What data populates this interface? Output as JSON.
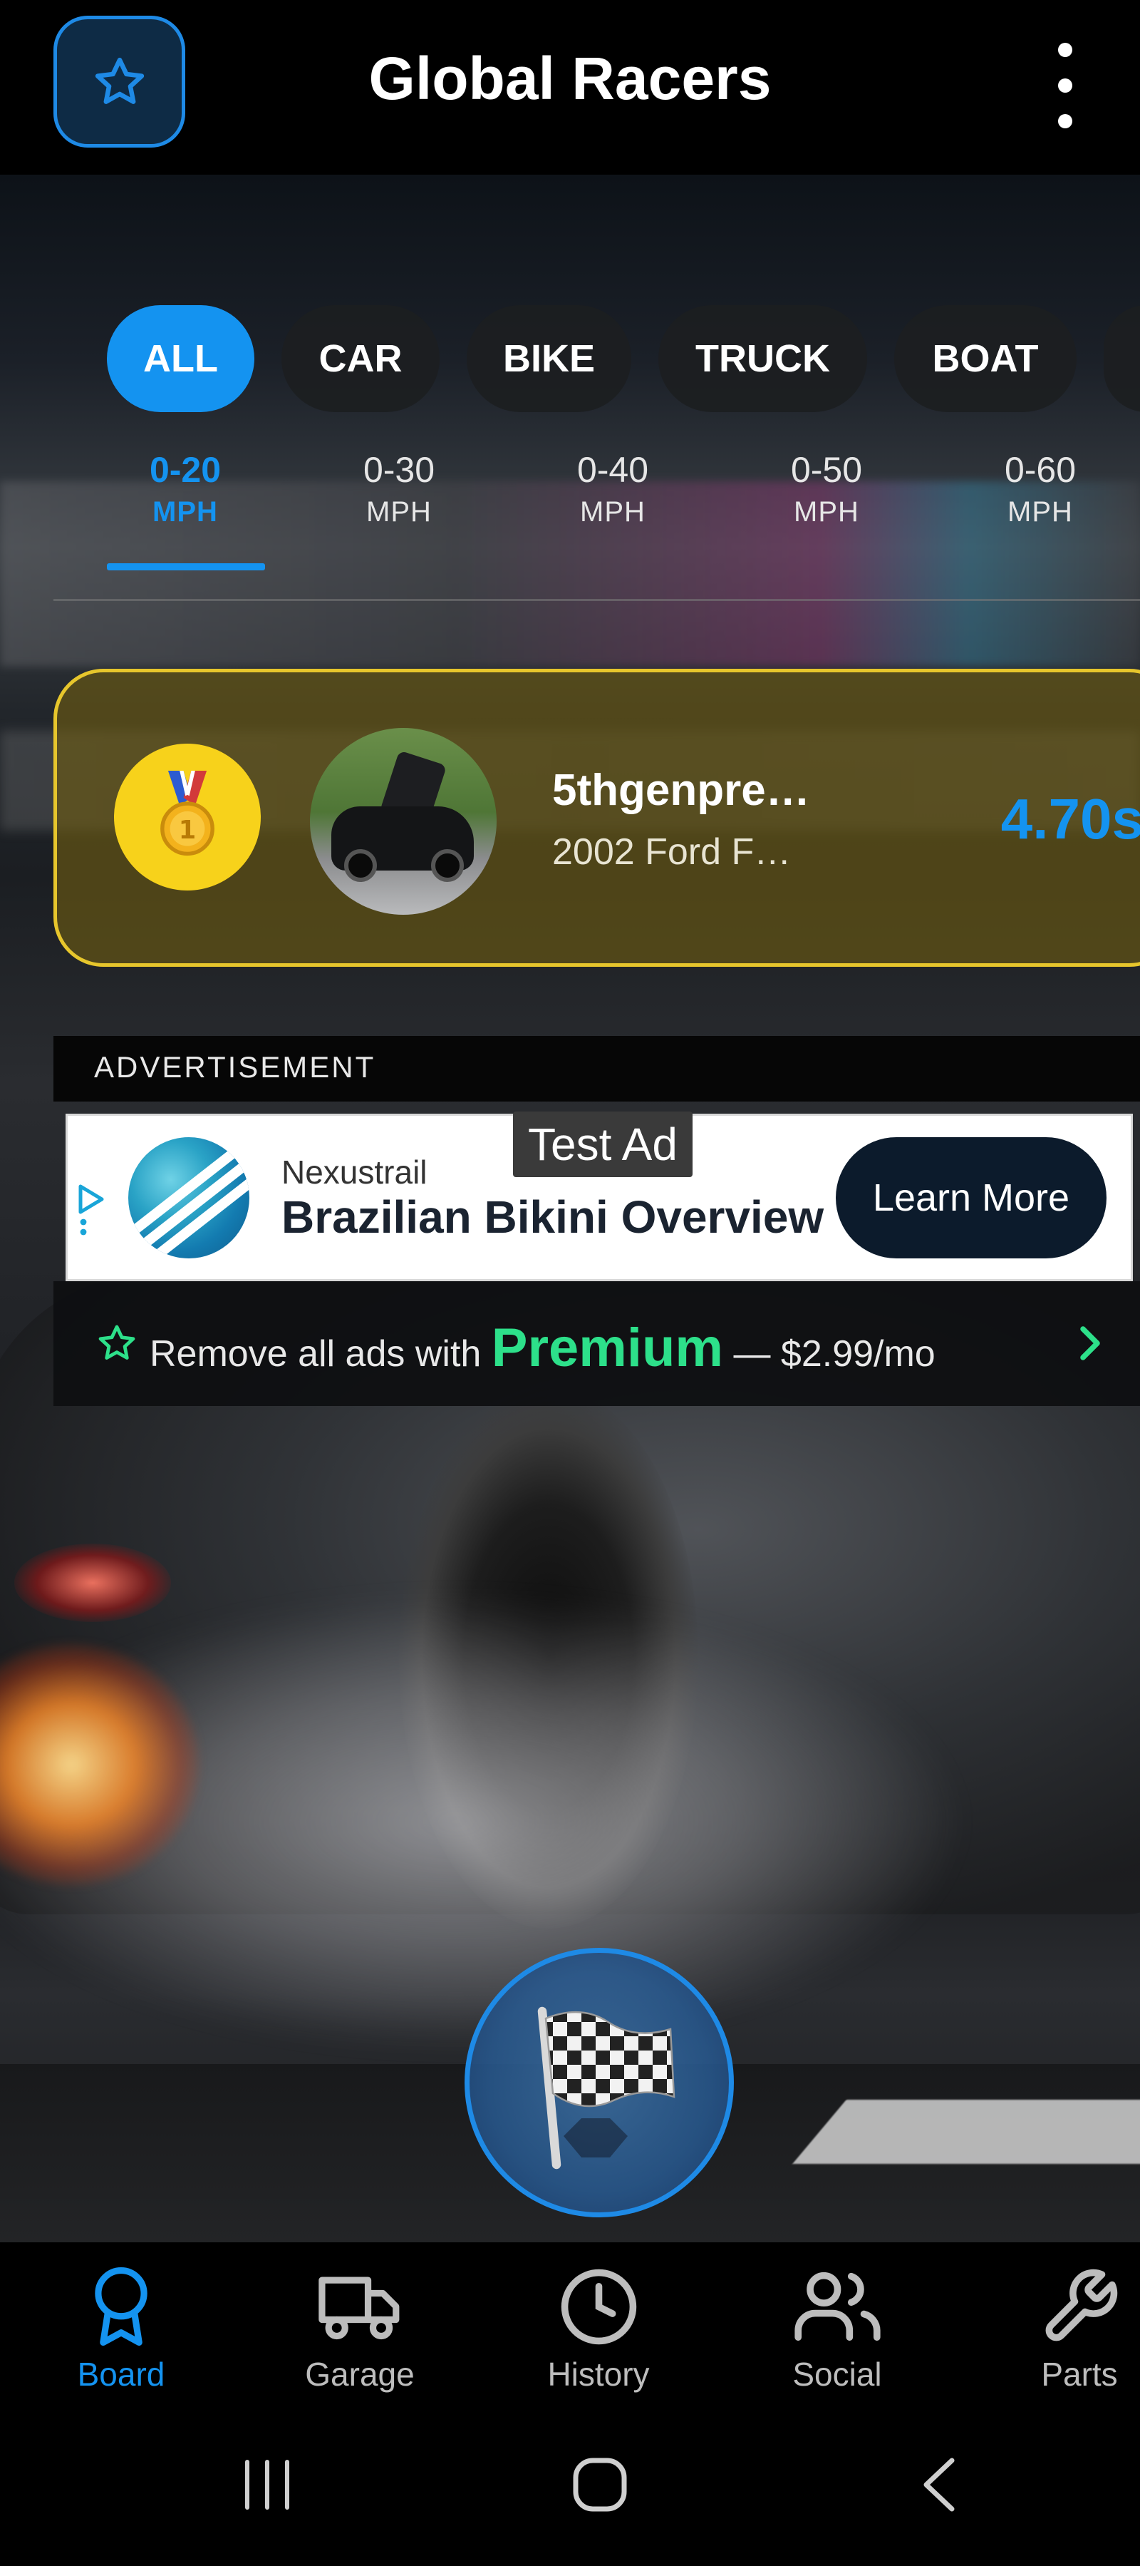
{
  "header": {
    "title": "Global Racers",
    "favorite_icon": "star-icon",
    "menu_icon": "more-vertical-icon"
  },
  "vehicle_filters": [
    {
      "label": "ALL",
      "active": true
    },
    {
      "label": "CAR",
      "active": false
    },
    {
      "label": "BIKE",
      "active": false
    },
    {
      "label": "TRUCK",
      "active": false
    },
    {
      "label": "BOAT",
      "active": false
    }
  ],
  "speed_tabs": [
    {
      "range": "0-20",
      "unit": "MPH",
      "active": true
    },
    {
      "range": "0-30",
      "unit": "MPH",
      "active": false
    },
    {
      "range": "0-40",
      "unit": "MPH",
      "active": false
    },
    {
      "range": "0-50",
      "unit": "MPH",
      "active": false
    },
    {
      "range": "0-60",
      "unit": "MPH",
      "active": false
    }
  ],
  "leaderboard": [
    {
      "rank_icon": "gold-medal-icon",
      "racer": "5thgenpre…",
      "vehicle": "2002 Ford F…",
      "time": "4.70s"
    }
  ],
  "ad": {
    "section_label": "ADVERTISEMENT",
    "badge": "Test Ad",
    "brand": "Nexustrail",
    "headline": "Brazilian Bikini Overview",
    "cta": "Learn More"
  },
  "premium": {
    "prefix": "Remove all ads with",
    "highlight": "Premium",
    "suffix": "— $2.99/mo"
  },
  "race_button_icon": "checkered-flag-icon",
  "bottom_nav": [
    {
      "label": "Board",
      "icon": "ribbon-icon",
      "active": true
    },
    {
      "label": "Garage",
      "icon": "truck-icon",
      "active": false
    },
    {
      "label": "History",
      "icon": "clock-icon",
      "active": false
    },
    {
      "label": "Social",
      "icon": "users-icon",
      "active": false
    },
    {
      "label": "Parts",
      "icon": "wrench-icon",
      "active": false
    }
  ],
  "colors": {
    "accent": "#1493f0",
    "gold": "#e7c62c",
    "premium_green": "#2de08a"
  }
}
